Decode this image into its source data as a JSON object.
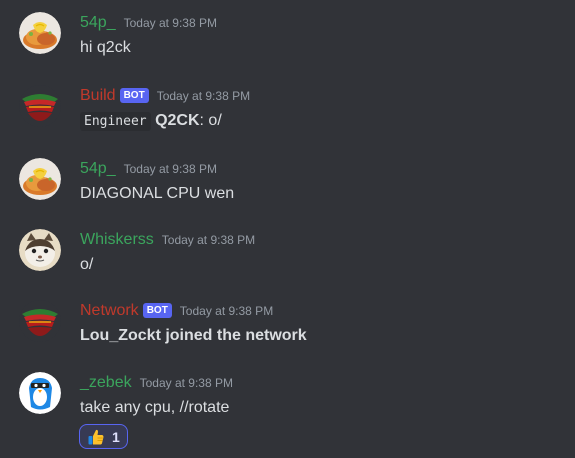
{
  "messages": [
    {
      "username": "54p_",
      "name_color": "#3ba55d",
      "avatar": "food-avatar",
      "is_bot": false,
      "timestamp": "Today at 9:38 PM",
      "text": "hi q2ck"
    },
    {
      "username": "Build",
      "name_color": "#c0392b",
      "avatar": "bot-avatar",
      "is_bot": true,
      "bot_label": "BOT",
      "timestamp": "Today at 9:38 PM",
      "code": "Engineer",
      "strong": "Q2CK",
      "rest": ": o/"
    },
    {
      "username": "54p_",
      "name_color": "#3ba55d",
      "avatar": "food-avatar",
      "is_bot": false,
      "timestamp": "Today at 9:38 PM",
      "text": "DIAGONAL CPU wen"
    },
    {
      "username": "Whiskerss",
      "name_color": "#3ba55d",
      "avatar": "cat-avatar",
      "is_bot": false,
      "timestamp": "Today at 9:38 PM",
      "text": "o/"
    },
    {
      "username": "Network",
      "name_color": "#c0392b",
      "avatar": "bot-avatar",
      "is_bot": true,
      "bot_label": "BOT",
      "timestamp": "Today at 9:38 PM",
      "text": "Lou_Zockt joined the network"
    },
    {
      "username": "_zebek",
      "name_color": "#3ba55d",
      "avatar": "penguin-avatar",
      "is_bot": false,
      "timestamp": "Today at 9:38 PM",
      "text": "take any cpu, //rotate",
      "reaction": {
        "emoji": "thumbs-up-icon",
        "count": "1"
      }
    }
  ],
  "colors": {
    "background": "#313338",
    "text": "#dbdee1",
    "timestamp": "#949ba4",
    "bot_tag": "#5865f2"
  }
}
